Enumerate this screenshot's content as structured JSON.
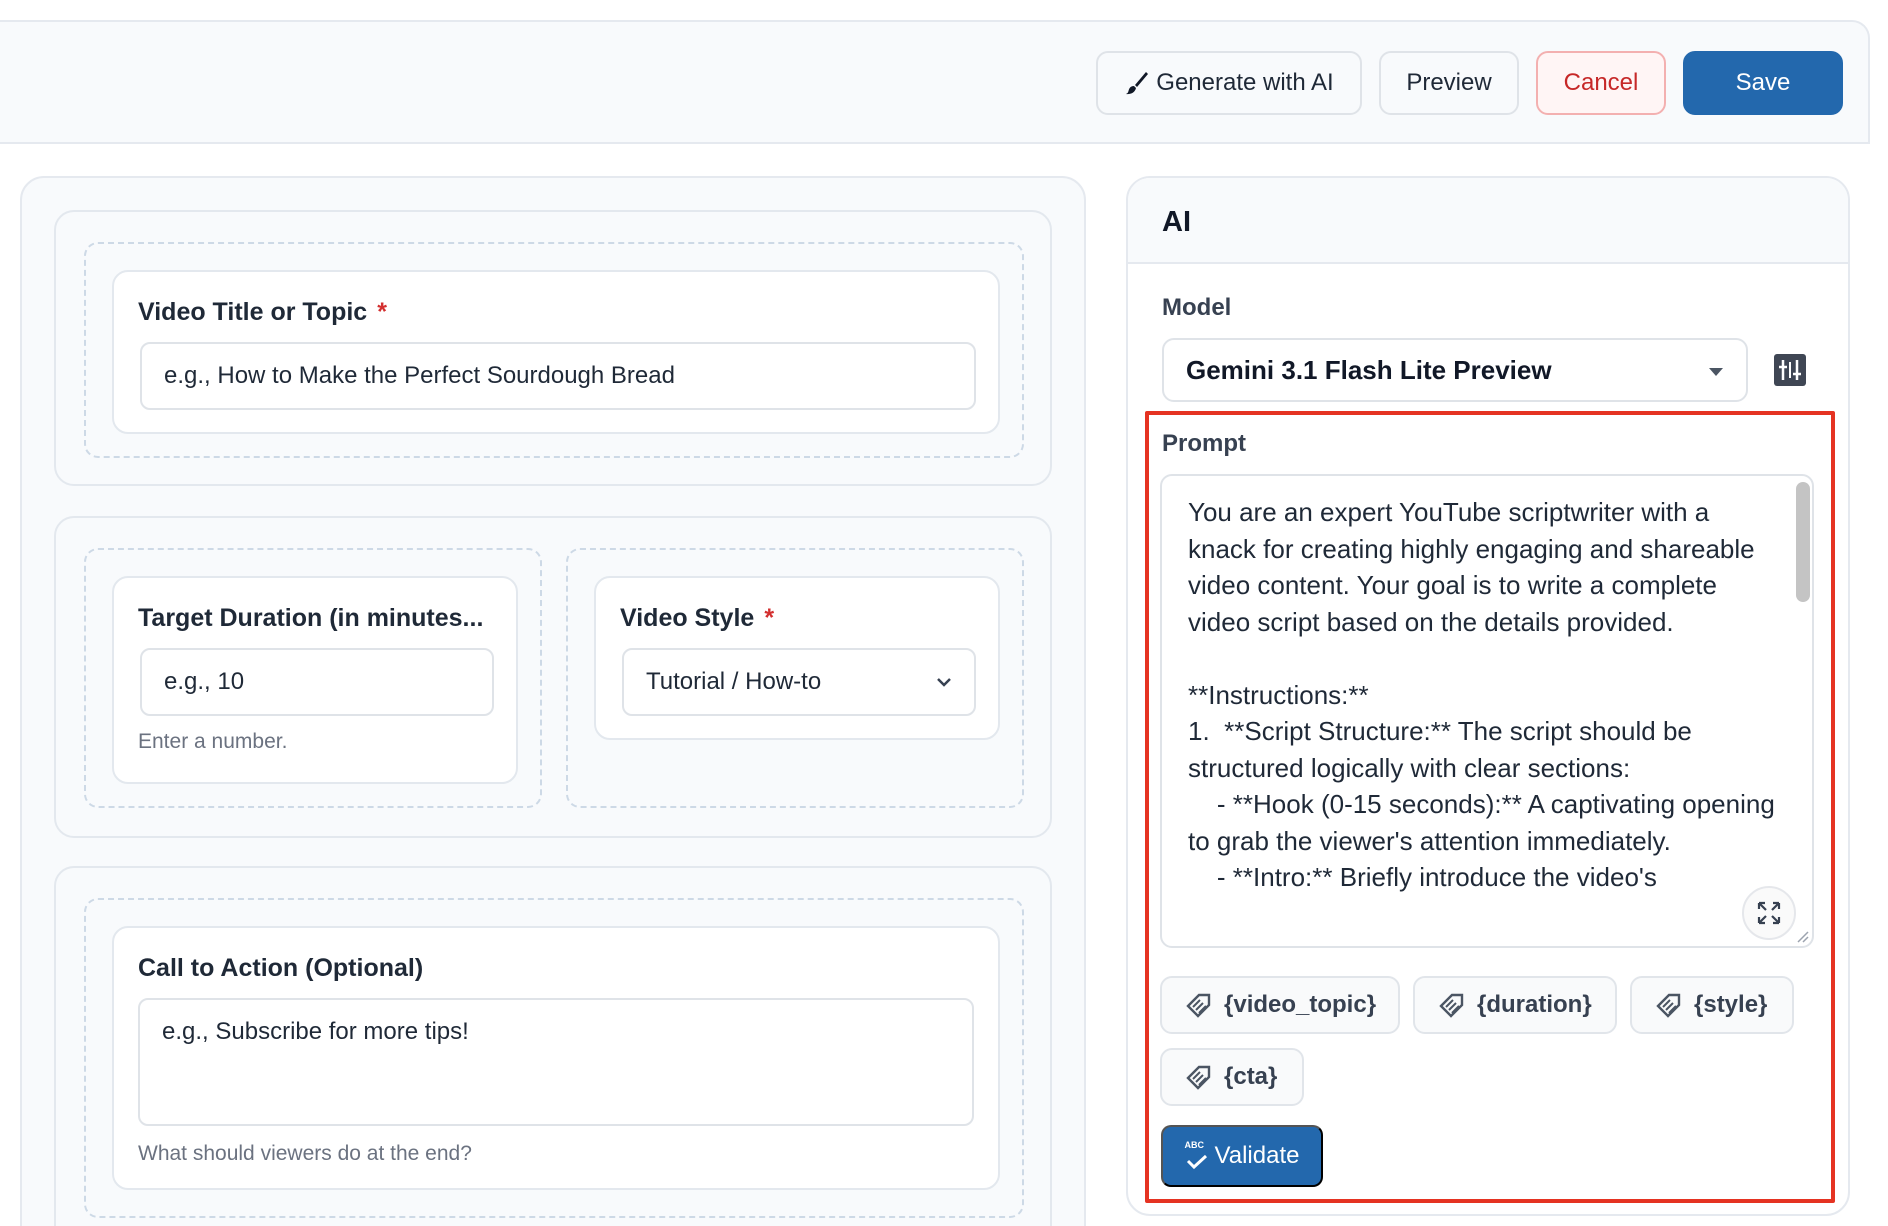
{
  "toolbar": {
    "generate_label": "Generate with AI",
    "preview_label": "Preview",
    "cancel_label": "Cancel",
    "save_label": "Save"
  },
  "form": {
    "video_title": {
      "label": "Video Title or Topic",
      "required_mark": "*",
      "placeholder": "e.g., How to Make the Perfect Sourdough Bread"
    },
    "duration": {
      "label": "Target Duration (in minutes...",
      "placeholder": "e.g., 10",
      "hint": "Enter a number."
    },
    "style": {
      "label": "Video Style",
      "required_mark": "*",
      "selected": "Tutorial / How-to"
    },
    "cta": {
      "label": "Call to Action (Optional)",
      "placeholder": "e.g., Subscribe for more tips!",
      "hint": "What should viewers do at the end?"
    }
  },
  "ai_panel": {
    "title": "AI",
    "model_label": "Model",
    "model_selected": "Gemini 3.1 Flash Lite Preview",
    "prompt_label": "Prompt",
    "prompt_text": "You are an expert YouTube scriptwriter with a knack for creating highly engaging and shareable video content. Your goal is to write a complete video script based on the details provided.\n\n**Instructions:**\n1.  **Script Structure:** The script should be structured logically with clear sections:\n    - **Hook (0-15 seconds):** A captivating opening to grab the viewer's attention immediately.\n    - **Intro:** Briefly introduce the video's",
    "variables": [
      "{video_topic}",
      "{duration}",
      "{style}",
      "{cta}"
    ],
    "validate_label": "Validate",
    "validate_badge": "ABC"
  },
  "icons": {
    "generate": "brush-icon",
    "model_settings": "sliders-icon",
    "expand": "expand-icon",
    "variable": "tag-icon",
    "validate": "spellcheck-icon"
  }
}
